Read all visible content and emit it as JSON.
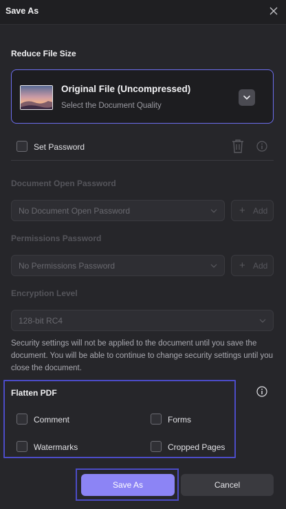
{
  "dialog": {
    "title": "Save As"
  },
  "reduce_size": {
    "heading": "Reduce File Size",
    "option_title": "Original File (Uncompressed)",
    "option_subtitle": "Select the Document Quality"
  },
  "password": {
    "set_password_label": "Set Password",
    "set_password_checked": false,
    "open_password_heading": "Document Open Password",
    "open_password_placeholder": "No Document Open Password",
    "permissions_heading": "Permissions Password",
    "permissions_placeholder": "No Permissions Password",
    "add_label": "Add",
    "encryption_heading": "Encryption Level",
    "encryption_value": "128-bit RC4",
    "info_text": "Security settings will not be applied to the document until you save the document. You will be able to continue to change security settings until you close the document."
  },
  "flatten": {
    "heading": "Flatten PDF",
    "options": {
      "comment": "Comment",
      "forms": "Forms",
      "watermarks": "Watermarks",
      "cropped_pages": "Cropped Pages"
    }
  },
  "footer": {
    "save_label": "Save As",
    "cancel_label": "Cancel"
  },
  "colors": {
    "accent": "#8c84f5",
    "highlight_border": "#4c4cc8",
    "card_border": "#6d6ff0",
    "background": "#26262a"
  },
  "icons": [
    "close-icon",
    "chevron-down-icon",
    "trash-icon",
    "info-icon",
    "plus-icon",
    "image-thumbnail"
  ]
}
